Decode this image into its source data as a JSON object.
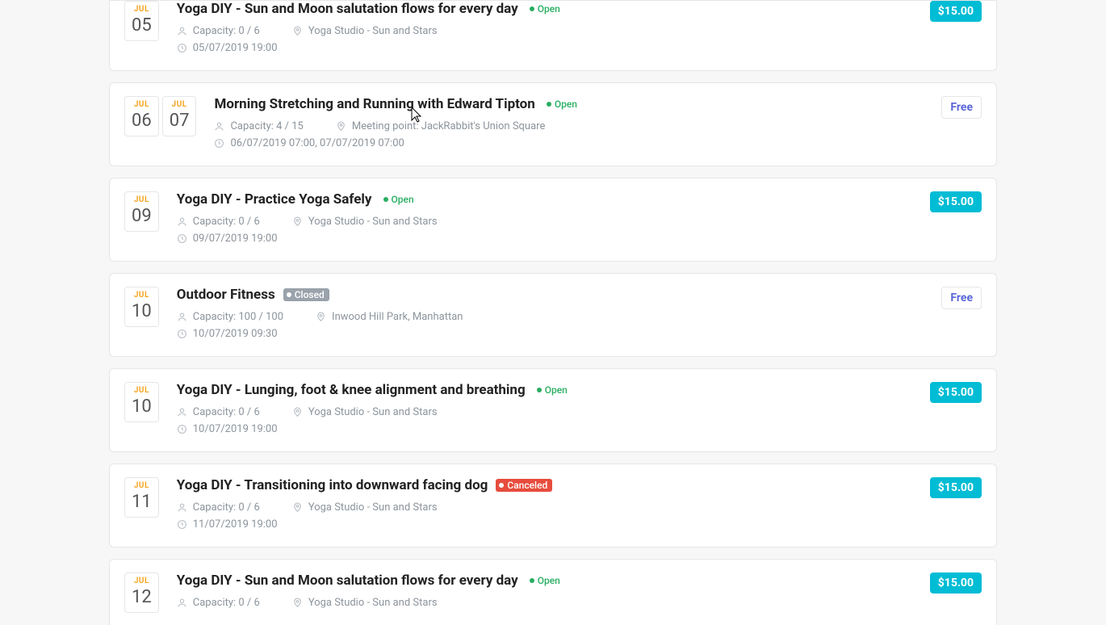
{
  "events": [
    {
      "dates": [
        {
          "month": "JUL",
          "day": "05"
        }
      ],
      "title": "Yoga DIY - Sun and Moon salutation flows for every day",
      "status": {
        "label": "Open",
        "kind": "open"
      },
      "capacity": "Capacity: 0 / 6",
      "location": "Yoga Studio - Sun and Stars",
      "time": "05/07/2019 19:00",
      "price": {
        "label": "$15.00",
        "kind": "paid"
      },
      "first": true
    },
    {
      "dates": [
        {
          "month": "JUL",
          "day": "06"
        },
        {
          "month": "JUL",
          "day": "07"
        }
      ],
      "title": "Morning Stretching and Running with Edward Tipton",
      "status": {
        "label": "Open",
        "kind": "open"
      },
      "capacity": "Capacity: 4 / 15",
      "location": "Meeting point: JackRabbit's Union Square",
      "time": "06/07/2019 07:00, 07/07/2019 07:00",
      "price": {
        "label": "Free",
        "kind": "free"
      },
      "cursor": true
    },
    {
      "dates": [
        {
          "month": "JUL",
          "day": "09"
        }
      ],
      "title": "Yoga DIY - Practice Yoga Safely",
      "status": {
        "label": "Open",
        "kind": "open"
      },
      "capacity": "Capacity: 0 / 6",
      "location": "Yoga Studio - Sun and Stars",
      "time": "09/07/2019 19:00",
      "price": {
        "label": "$15.00",
        "kind": "paid"
      }
    },
    {
      "dates": [
        {
          "month": "JUL",
          "day": "10"
        }
      ],
      "title": "Outdoor Fitness",
      "status": {
        "label": "Closed",
        "kind": "closed"
      },
      "capacity": "Capacity: 100 / 100",
      "location": "Inwood Hill Park, Manhattan",
      "time": "10/07/2019 09:30",
      "price": {
        "label": "Free",
        "kind": "free"
      }
    },
    {
      "dates": [
        {
          "month": "JUL",
          "day": "10"
        }
      ],
      "title": "Yoga DIY - Lunging, foot & knee alignment and breathing",
      "status": {
        "label": "Open",
        "kind": "open"
      },
      "capacity": "Capacity: 0 / 6",
      "location": "Yoga Studio - Sun and Stars",
      "time": "10/07/2019 19:00",
      "price": {
        "label": "$15.00",
        "kind": "paid"
      }
    },
    {
      "dates": [
        {
          "month": "JUL",
          "day": "11"
        }
      ],
      "title": "Yoga DIY - Transitioning into downward facing dog",
      "status": {
        "label": "Canceled",
        "kind": "canceled"
      },
      "capacity": "Capacity: 0 / 6",
      "location": "Yoga Studio - Sun and Stars",
      "time": "11/07/2019 19:00",
      "price": {
        "label": "$15.00",
        "kind": "paid"
      }
    },
    {
      "dates": [
        {
          "month": "JUL",
          "day": "12"
        }
      ],
      "title": "Yoga DIY - Sun and Moon salutation flows for every day",
      "status": {
        "label": "Open",
        "kind": "open"
      },
      "capacity": "Capacity: 0 / 6",
      "location": "Yoga Studio - Sun and Stars",
      "time": "",
      "price": {
        "label": "$15.00",
        "kind": "paid"
      },
      "cut": true
    }
  ]
}
